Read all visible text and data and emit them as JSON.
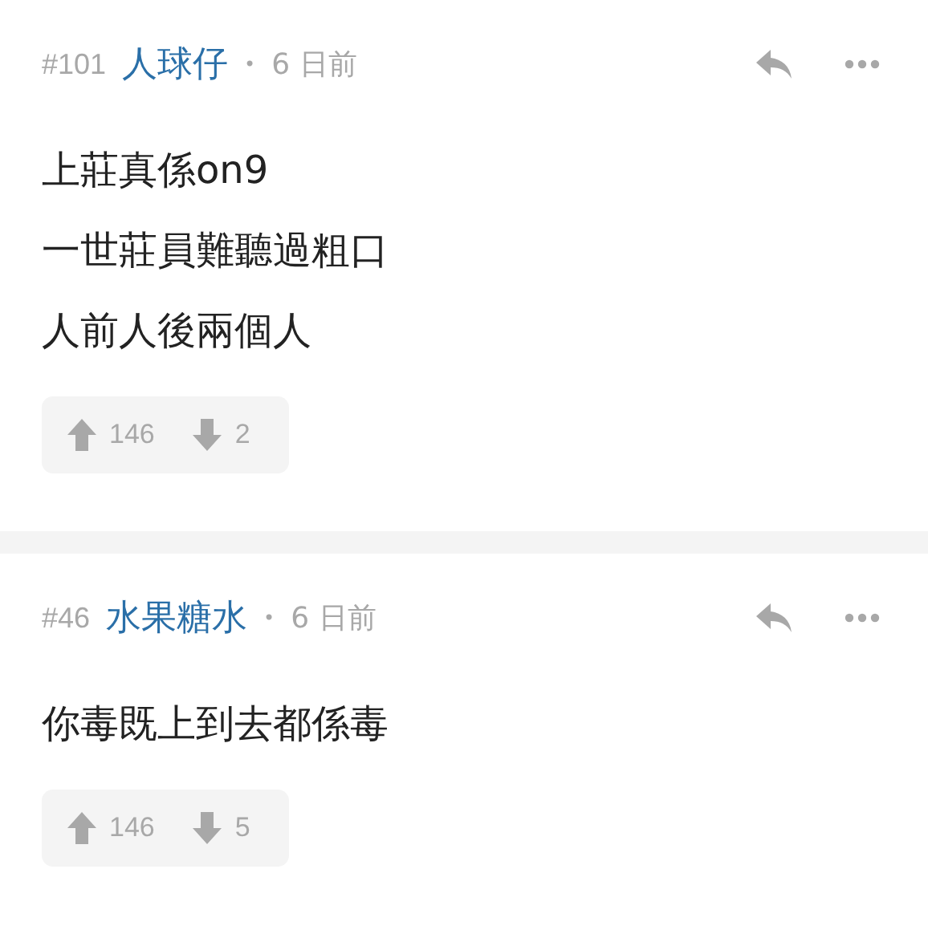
{
  "posts": [
    {
      "number": "#101",
      "author": "人球仔",
      "separator": "•",
      "time": "6 日前",
      "lines": [
        "上莊真係on9",
        "一世莊員難聽過粗口",
        "人前人後兩個人"
      ],
      "upvotes": "146",
      "downvotes": "2"
    },
    {
      "number": "#46",
      "author": "水果糖水",
      "separator": "•",
      "time": "6 日前",
      "lines": [
        "你毒既上到去都係毒"
      ],
      "upvotes": "146",
      "downvotes": "5"
    }
  ]
}
